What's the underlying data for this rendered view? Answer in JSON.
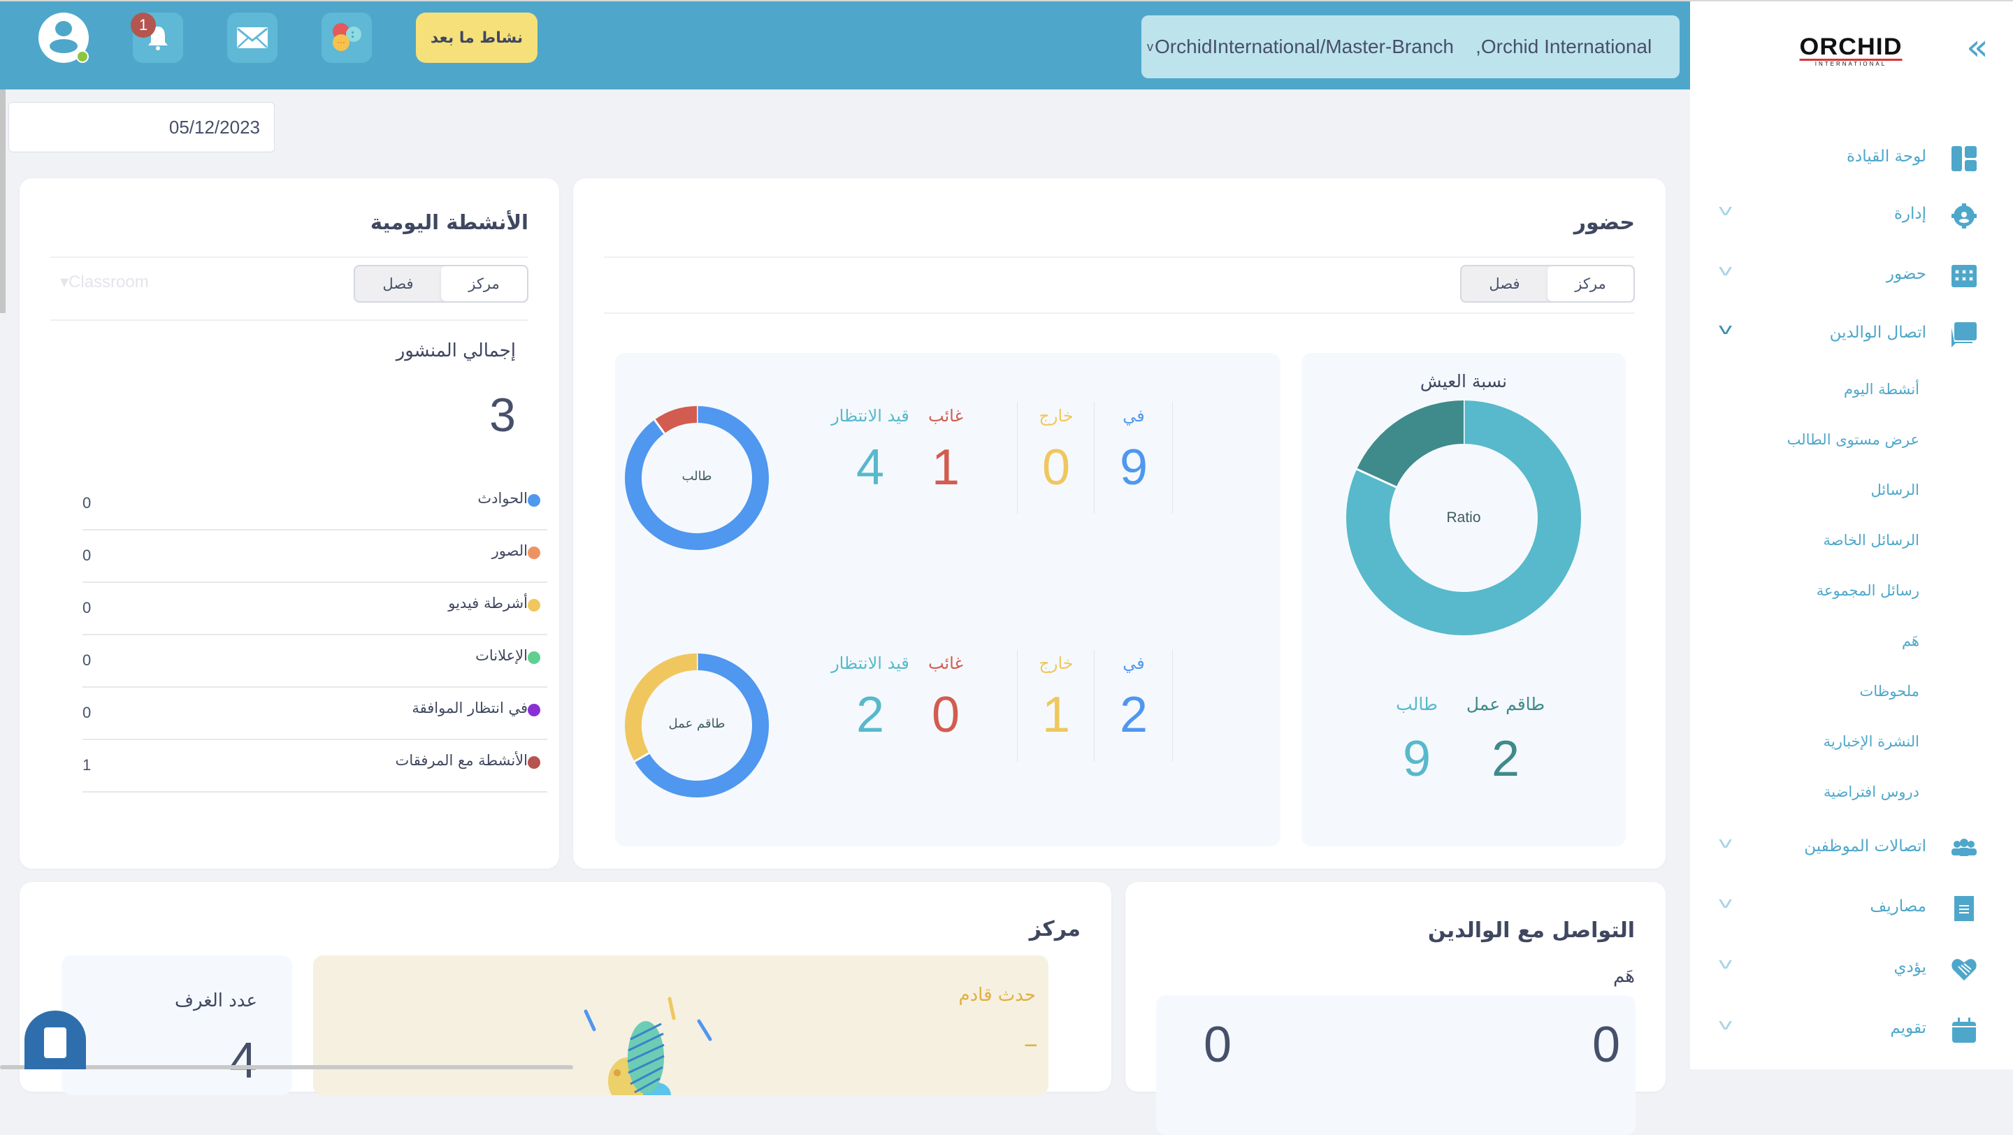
{
  "header": {
    "notification_count": "1",
    "activity_button_label": "نشاط ما بعد",
    "branch_select_value": "Orchid International,   OrchidInternational/Master-Branch",
    "branch_chevron": "v",
    "icons": [
      "avatar-icon",
      "bell-icon",
      "mail-icon",
      "chat-bubbles-icon"
    ],
    "colors": {
      "bar": "#4ea7ca",
      "activity_button": "#f6e07a",
      "badge": "#b55550",
      "online": "#8cc63f"
    }
  },
  "sidebar": {
    "logo_text": "ORCHID",
    "logo_subtext": "INTERNATIONAL",
    "collapse_icon": "«",
    "items": [
      {
        "label": "لوحة القيادة",
        "icon": "dashboard-icon",
        "expandable": false
      },
      {
        "label": "إدارة",
        "icon": "admin-gear-icon",
        "expandable": true,
        "expanded": false
      },
      {
        "label": "حضور",
        "icon": "attendance-calendar-icon",
        "expandable": true,
        "expanded": false
      },
      {
        "label": "اتصال الوالدين",
        "icon": "parent-chat-icon",
        "expandable": true,
        "expanded": true
      },
      {
        "label": "اتصالات الموظفين",
        "icon": "staff-group-icon",
        "expandable": true,
        "expanded": false
      },
      {
        "label": "مصاريف",
        "icon": "receipt-icon",
        "expandable": true,
        "expanded": false
      },
      {
        "label": "يؤدي",
        "icon": "handshake-heart-icon",
        "expandable": true,
        "expanded": false
      },
      {
        "label": "تقويم",
        "icon": "calendar-icon",
        "expandable": true,
        "expanded": false
      }
    ],
    "subitems": [
      "أنشطة اليوم",
      "عرض مستوى الطالب",
      "الرسائل",
      "الرسائل الخاصة",
      "رسائل المجموعة",
      "هَم",
      "ملحوظات",
      "النشرة الإخبارية",
      "دروس افتراضية"
    ],
    "chevron": "v"
  },
  "date_input": {
    "value": "05/12/2023"
  },
  "daily_activities": {
    "title": "الأنشطة اليومية",
    "toggle": {
      "options": [
        "مركز",
        "فصل"
      ],
      "active": "مركز"
    },
    "classroom_select_placeholder": "▾Classroom",
    "total_label": "إجمالي المنشور",
    "total_value": "3",
    "rows": [
      {
        "label": "الحوادث",
        "value": "0",
        "color": "#4f97ef"
      },
      {
        "label": "الصور",
        "value": "0",
        "color": "#ef9262"
      },
      {
        "label": "أشرطة فيديو",
        "value": "0",
        "color": "#f0c75e"
      },
      {
        "label": "الإعلانات",
        "value": "0",
        "color": "#5fd08f"
      },
      {
        "label": "في انتظار الموافقة",
        "value": "0",
        "color": "#8a2fd5"
      },
      {
        "label": "الأنشطة مع المرفقات",
        "value": "1",
        "color": "#b7524f"
      }
    ]
  },
  "attendance": {
    "title": "حضور",
    "toggle": {
      "options": [
        "مركز",
        "فصل"
      ],
      "active": "مركز"
    },
    "ratio": {
      "title": "نسبة العيش",
      "center_label": "Ratio",
      "staff_label": "طاقم عمل",
      "staff_value": "2",
      "student_label": "طالب",
      "student_value": "9",
      "staff_color": "#3f8a8b",
      "student_color": "#57b9cb"
    },
    "student": {
      "center_label": "طالب",
      "in_label": "في",
      "in_value": "9",
      "out_label": "خارج",
      "out_value": "0",
      "absent_label": "غائب",
      "absent_value": "1",
      "pending_label": "قيد الانتظار",
      "pending_value": "4"
    },
    "staff": {
      "center_label": "طاقم عمل",
      "in_label": "في",
      "in_value": "2",
      "out_label": "خارج",
      "out_value": "1",
      "absent_label": "غائب",
      "absent_value": "0",
      "pending_label": "قيد الانتظار",
      "pending_value": "2"
    },
    "colors": {
      "in": "#4f97ef",
      "out": "#f0c75e",
      "absent": "#d25c4f",
      "pending": "#57b9cb"
    }
  },
  "center_card": {
    "title": "مركز",
    "rooms_label": "عدد الغرف",
    "rooms_value": "4",
    "upcoming_event_label": "حدث قادم",
    "upcoming_event_value": "---"
  },
  "parent_comm": {
    "title": "التواصل مع الوالدين",
    "subtitle": "هَم",
    "values": [
      "0",
      "0"
    ]
  },
  "chart_data": [
    {
      "type": "pie",
      "title": "نسبة العيش",
      "center_label": "Ratio",
      "categories": [
        "طالب",
        "طاقم عمل"
      ],
      "values": [
        9,
        2
      ],
      "colors": [
        "#57b9cb",
        "#3f8a8b"
      ]
    },
    {
      "type": "pie",
      "title": "طالب",
      "categories": [
        "في",
        "غائب"
      ],
      "values": [
        9,
        1
      ],
      "colors": [
        "#4f97ef",
        "#d25c4f"
      ]
    },
    {
      "type": "pie",
      "title": "طاقم عمل",
      "categories": [
        "في",
        "خارج"
      ],
      "values": [
        2,
        1
      ],
      "colors": [
        "#4f97ef",
        "#f0c75e"
      ]
    }
  ]
}
